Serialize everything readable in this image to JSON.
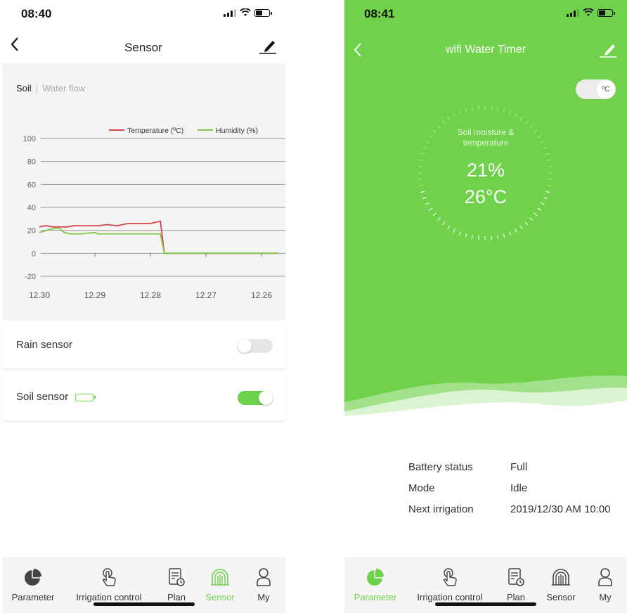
{
  "left": {
    "status_time": "08:40",
    "title": "Sensor",
    "segments": {
      "active": "Soil",
      "separator": "|",
      "inactive": "Water flow"
    },
    "chart_data": {
      "type": "line",
      "x": [
        "12.30",
        "12.29",
        "12.28",
        "12.27",
        "12.26"
      ],
      "ylim": [
        -20,
        100
      ],
      "yticks": [
        "100",
        "80",
        "60",
        "40",
        "20",
        "0",
        "-20"
      ],
      "legend_placement": "top-right",
      "grid": true,
      "series": [
        {
          "name": "Temperature (ºC)",
          "color": "#d9434a",
          "points": [
            [
              0,
              23
            ],
            [
              0.12,
              24
            ],
            [
              0.25,
              23
            ],
            [
              0.5,
              23
            ],
            [
              0.62,
              24
            ],
            [
              0.88,
              24
            ],
            [
              1.05,
              24
            ],
            [
              1.22,
              25
            ],
            [
              1.4,
              24
            ],
            [
              1.6,
              26
            ],
            [
              2.0,
              26
            ],
            [
              2.18,
              28
            ],
            [
              2.25,
              0
            ],
            [
              4.3,
              0
            ]
          ]
        },
        {
          "name": "Humidity (%)",
          "color": "#7dc846",
          "points": [
            [
              0,
              18
            ],
            [
              0.2,
              21
            ],
            [
              0.35,
              22
            ],
            [
              0.45,
              18
            ],
            [
              0.55,
              17
            ],
            [
              0.75,
              17
            ],
            [
              1.0,
              18
            ],
            [
              1.05,
              17
            ],
            [
              1.5,
              17
            ],
            [
              2.0,
              17
            ],
            [
              2.18,
              17
            ],
            [
              2.25,
              0
            ],
            [
              4.3,
              0
            ]
          ]
        }
      ]
    },
    "rows": {
      "rain": {
        "label": "Rain sensor",
        "state": "off"
      },
      "soil": {
        "label": "Soil sensor",
        "state": "on"
      }
    },
    "tabs": [
      {
        "label": "Parameter",
        "icon": "pie-chart-icon"
      },
      {
        "label": "Irrigation control",
        "icon": "touch-icon"
      },
      {
        "label": "Plan",
        "icon": "plan-icon"
      },
      {
        "label": "Sensor",
        "icon": "sensor-icon"
      },
      {
        "label": "My",
        "icon": "user-icon"
      }
    ],
    "active_tab": "Sensor"
  },
  "right": {
    "status_time": "08:41",
    "title": "wifi Water Timer",
    "unit": "ºC",
    "dial": {
      "label": "Soil moisture & temperature",
      "moisture": "21%",
      "temperature": "26°C"
    },
    "info": [
      {
        "label": "Battery status",
        "value": "Full"
      },
      {
        "label": "Mode",
        "value": "Idle"
      },
      {
        "label": "Next irrigation",
        "value": "2019/12/30 AM 10:00"
      }
    ],
    "tabs": [
      {
        "label": "Parameter",
        "icon": "pie-chart-icon"
      },
      {
        "label": "Irrigation control",
        "icon": "touch-icon"
      },
      {
        "label": "Plan",
        "icon": "plan-icon"
      },
      {
        "label": "Sensor",
        "icon": "sensor-icon"
      },
      {
        "label": "My",
        "icon": "user-icon"
      }
    ],
    "active_tab": "Parameter"
  },
  "colors": {
    "accent": "#6dd14a",
    "green_bg": "#70d24a",
    "temperature": "#d9434a",
    "humidity": "#7dc846"
  }
}
